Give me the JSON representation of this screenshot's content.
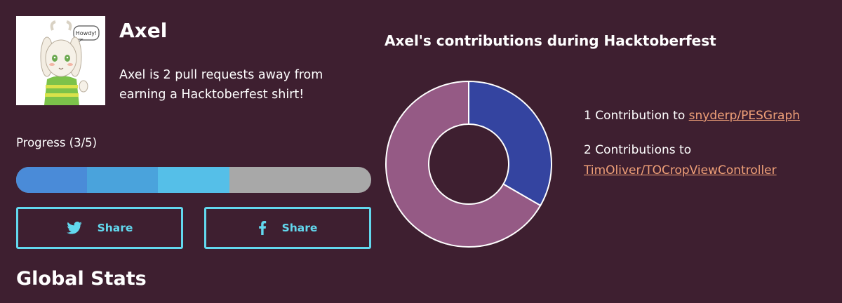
{
  "profile": {
    "name": "Axel",
    "status": "Axel is 2 pull requests away from earning a Hacktoberfest shirt!",
    "avatar_caption": "Howdy!"
  },
  "progress": {
    "label": "Progress (3/5)",
    "current": 3,
    "total": 5,
    "segment_colors": [
      "#4a8bd8",
      "#4aa3dc",
      "#55bfe8"
    ],
    "track_color": "#a8a8a8"
  },
  "share": {
    "twitter_label": "Share",
    "facebook_label": "Share",
    "twitter_icon": "twitter-bird-icon",
    "facebook_icon": "facebook-f-icon",
    "accent_color": "#62d8ee"
  },
  "global_stats": {
    "title": "Global Stats"
  },
  "contributions": {
    "title": "Axel's contributions during Hacktoberfest",
    "items": [
      {
        "prefix": "1 Contribution to",
        "repo": "snyderp/PESGraph"
      },
      {
        "prefix": "2 Contributions to",
        "repo": "TimOliver/TOCropViewController"
      }
    ],
    "link_color": "#f0a078"
  },
  "chart_data": {
    "type": "pie",
    "variant": "donut",
    "categories": [
      "snyderp/PESGraph",
      "TimOliver/TOCropViewController"
    ],
    "values": [
      1,
      2
    ],
    "colors": [
      "#3444a0",
      "#955a85"
    ],
    "title": "Axel's contributions during Hacktoberfest",
    "legend": "right"
  }
}
